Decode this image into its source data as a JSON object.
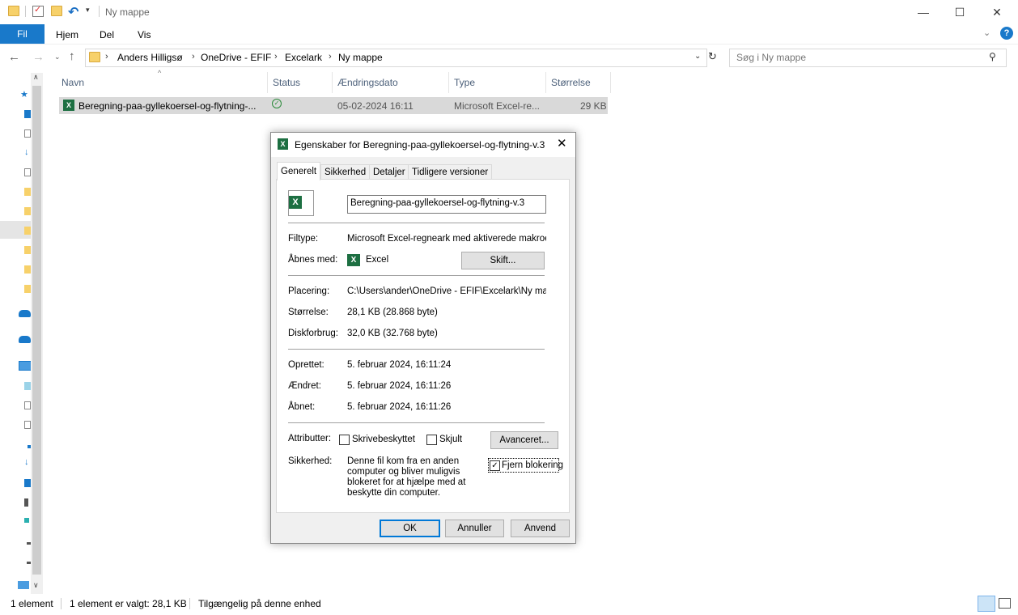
{
  "window": {
    "title": "Ny mappe",
    "minimize": "—",
    "maximize": "☐",
    "close": "✕"
  },
  "ribbon": {
    "file": "Fil",
    "tabs": [
      "Hjem",
      "Del",
      "Vis"
    ]
  },
  "address": {
    "crumbs": [
      "Anders Hilligsø",
      "OneDrive - EFIF",
      "Excelark",
      "Ny mappe"
    ],
    "search_placeholder": "Søg i Ny mappe"
  },
  "list": {
    "columns": [
      "Navn",
      "Status",
      "Ændringsdato",
      "Type",
      "Størrelse"
    ],
    "rows": [
      {
        "name": "Beregning-paa-gyllekoersel-og-flytning-...",
        "status": "✓",
        "date": "05-02-2024 16:11",
        "type": "Microsoft Excel-re...",
        "size": "29 KB"
      }
    ]
  },
  "statusbar": {
    "count": "1 element",
    "selected": "1 element er valgt: 28,1 KB",
    "availability": "Tilgængelig på denne enhed"
  },
  "dialog": {
    "title": "Egenskaber for Beregning-paa-gyllekoersel-og-flytning-v.3",
    "tabs": [
      "Generelt",
      "Sikkerhed",
      "Detaljer",
      "Tidligere versioner"
    ],
    "filename": "Beregning-paa-gyllekoersel-og-flytning-v.3",
    "filetype_label": "Filtype:",
    "filetype_value": "Microsoft Excel-regneark med aktiverede makroer (.x",
    "opens_label": "Åbnes med:",
    "opens_value": "Excel",
    "change_button": "Skift...",
    "location_label": "Placering:",
    "location_value": "C:\\Users\\ander\\OneDrive - EFIF\\Excelark\\Ny mapp",
    "size_label": "Størrelse:",
    "size_value": "28,1 KB (28.868 byte)",
    "disk_label": "Diskforbrug:",
    "disk_value": "32,0 KB (32.768 byte)",
    "created_label": "Oprettet:",
    "created_value": "5. februar 2024, 16:11:24",
    "modified_label": "Ændret:",
    "modified_value": "5. februar 2024, 16:11:26",
    "accessed_label": "Åbnet:",
    "accessed_value": "5. februar 2024, 16:11:26",
    "attributes_label": "Attributter:",
    "readonly_label": "Skrivebeskyttet",
    "hidden_label": "Skjult",
    "advanced_button": "Avanceret...",
    "security_label": "Sikkerhed:",
    "security_text": "Denne fil kom fra en anden computer og bliver muligvis blokeret for at hjælpe med at beskytte din computer.",
    "unblock_label": "Fjern blokering",
    "unblock_checked": true,
    "ok": "OK",
    "cancel": "Annuller",
    "apply": "Anvend"
  }
}
